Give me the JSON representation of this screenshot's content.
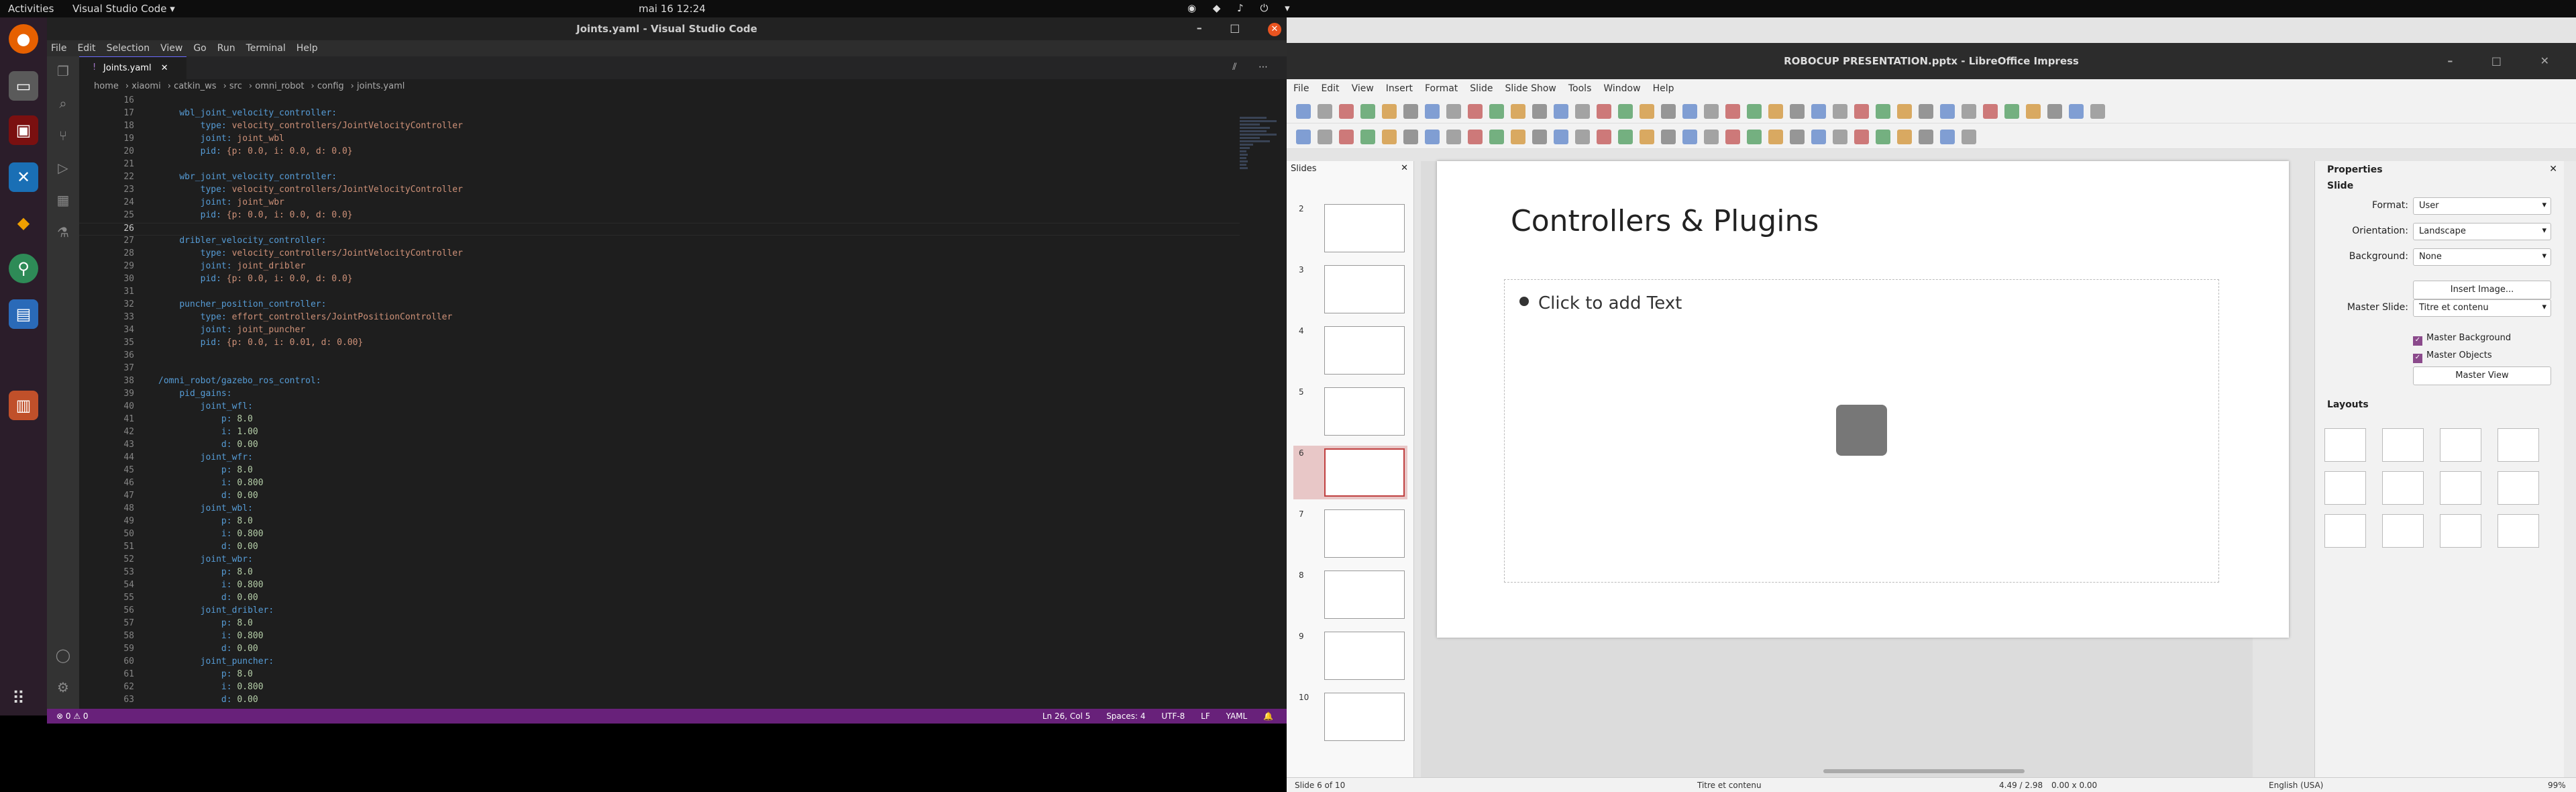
{
  "topbar": {
    "activities": "Activities",
    "app_menu": "Visual Studio Code ▾",
    "clock": "mai 16  12:24",
    "tray": "⏻ ▾"
  },
  "vscode": {
    "window_title": "Joints.yaml - Visual Studio Code",
    "menu": [
      "File",
      "Edit",
      "Selection",
      "View",
      "Go",
      "Run",
      "Terminal",
      "Help"
    ],
    "tab_label": "Joints.yaml",
    "breadcrumb": [
      "home",
      "xiaomi",
      "catkin_ws",
      "src",
      "omni_robot",
      "config",
      "joints.yaml"
    ],
    "lines": [
      {
        "n": "16",
        "t": ""
      },
      {
        "n": "17",
        "t": "    wbl_joint_velocity_controller:"
      },
      {
        "n": "18",
        "t": "        type: velocity_controllers/JointVelocityController"
      },
      {
        "n": "19",
        "t": "        joint: joint_wbl"
      },
      {
        "n": "20",
        "t": "        pid: {p: 0.0, i: 0.0, d: 0.0}"
      },
      {
        "n": "21",
        "t": ""
      },
      {
        "n": "22",
        "t": "    wbr_joint_velocity_controller:"
      },
      {
        "n": "23",
        "t": "        type: velocity_controllers/JointVelocityController"
      },
      {
        "n": "24",
        "t": "        joint: joint_wbr"
      },
      {
        "n": "25",
        "t": "        pid: {p: 0.0, i: 0.0, d: 0.0}"
      },
      {
        "n": "26",
        "t": "    "
      },
      {
        "n": "27",
        "t": "    dribler_velocity_controller:"
      },
      {
        "n": "28",
        "t": "        type: velocity_controllers/JointVelocityController"
      },
      {
        "n": "29",
        "t": "        joint: joint_dribler"
      },
      {
        "n": "30",
        "t": "        pid: {p: 0.0, i: 0.0, d: 0.0}"
      },
      {
        "n": "31",
        "t": ""
      },
      {
        "n": "32",
        "t": "    puncher_position_controller:"
      },
      {
        "n": "33",
        "t": "        type: effort_controllers/JointPositionController"
      },
      {
        "n": "34",
        "t": "        joint: joint_puncher"
      },
      {
        "n": "35",
        "t": "        pid: {p: 0.0, i: 0.01, d: 0.00}"
      },
      {
        "n": "36",
        "t": ""
      },
      {
        "n": "37",
        "t": ""
      },
      {
        "n": "38",
        "t": "/omni_robot/gazebo_ros_control:"
      },
      {
        "n": "39",
        "t": "    pid_gains:"
      },
      {
        "n": "40",
        "t": "        joint_wfl:"
      },
      {
        "n": "41",
        "t": "            p: 8.0"
      },
      {
        "n": "42",
        "t": "            i: 1.00"
      },
      {
        "n": "43",
        "t": "            d: 0.00"
      },
      {
        "n": "44",
        "t": "        joint_wfr:"
      },
      {
        "n": "45",
        "t": "            p: 8.0"
      },
      {
        "n": "46",
        "t": "            i: 0.800"
      },
      {
        "n": "47",
        "t": "            d: 0.00"
      },
      {
        "n": "48",
        "t": "        joint_wbl:"
      },
      {
        "n": "49",
        "t": "            p: 8.0"
      },
      {
        "n": "50",
        "t": "            i: 0.800"
      },
      {
        "n": "51",
        "t": "            d: 0.00"
      },
      {
        "n": "52",
        "t": "        joint_wbr:"
      },
      {
        "n": "53",
        "t": "            p: 8.0"
      },
      {
        "n": "54",
        "t": "            i: 0.800"
      },
      {
        "n": "55",
        "t": "            d: 0.00"
      },
      {
        "n": "56",
        "t": "        joint_dribler:"
      },
      {
        "n": "57",
        "t": "            p: 8.0"
      },
      {
        "n": "58",
        "t": "            i: 0.800"
      },
      {
        "n": "59",
        "t": "            d: 0.00"
      },
      {
        "n": "60",
        "t": "        joint_puncher:"
      },
      {
        "n": "61",
        "t": "            p: 8.0"
      },
      {
        "n": "62",
        "t": "            i: 0.800"
      },
      {
        "n": "63",
        "t": "            d: 0.00"
      }
    ],
    "current_line": "26",
    "status": {
      "problems": "⊗ 0 ⚠ 0",
      "position": "Ln 26, Col 5",
      "spaces": "Spaces: 4",
      "encoding": "UTF-8",
      "eol": "LF",
      "language": "YAML"
    }
  },
  "impress": {
    "window_title": "ROBOCUP PRESENTATION.pptx - LibreOffice Impress",
    "menu": [
      "File",
      "Edit",
      "View",
      "Insert",
      "Format",
      "Slide",
      "Slide Show",
      "Tools",
      "Window",
      "Help"
    ],
    "slides_label": "Slides",
    "slide_numbers": [
      "2",
      "3",
      "4",
      "5",
      "6",
      "7",
      "8",
      "9",
      "10"
    ],
    "selected_slide": "6",
    "slide": {
      "title": "Controllers & Plugins",
      "placeholder": "Click to add Text"
    },
    "properties": {
      "title": "Properties",
      "section_slide": "Slide",
      "format_label": "Format:",
      "format_value": "User",
      "orientation_label": "Orientation:",
      "orientation_value": "Landscape",
      "background_label": "Background:",
      "background_value": "None",
      "insert_image": "Insert Image...",
      "master_slide_label": "Master Slide:",
      "master_slide_value": "Titre et contenu",
      "master_background": "Master Background",
      "master_objects": "Master Objects",
      "master_view": "Master View",
      "section_layouts": "Layouts"
    },
    "status": {
      "slide_of": "Slide 6 of 10",
      "layout": "Titre et contenu",
      "position": "4.49 / 2.98",
      "size": "0.00 x 0.00",
      "language": "English (USA)",
      "zoom": "99%"
    }
  }
}
